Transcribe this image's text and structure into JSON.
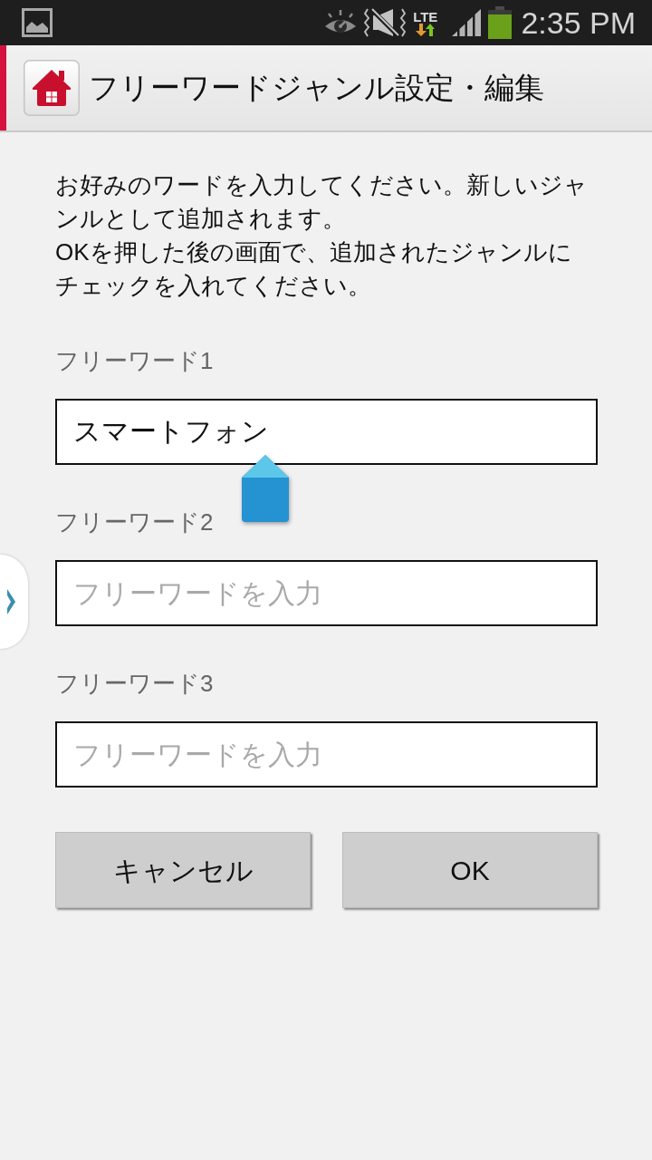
{
  "status_bar": {
    "network": "LTE",
    "time": "2:35 PM"
  },
  "header": {
    "title": "フリーワードジャンル設定・編集"
  },
  "instructions": [
    "お好みのワードを入力してください。新しいジャンルとして追加されます。",
    "OKを押した後の画面で、追加されたジャンルにチェックを入れてください。"
  ],
  "fields": [
    {
      "label": "フリーワード1",
      "value": "スマートフォン",
      "focused": true
    },
    {
      "label": "フリーワード2",
      "placeholder": "フリーワードを入力",
      "focused": false
    },
    {
      "label": "フリーワード3",
      "placeholder": "フリーワードを入力",
      "focused": false
    }
  ],
  "buttons": [
    {
      "label": "キャンセル"
    },
    {
      "label": "OK"
    }
  ]
}
